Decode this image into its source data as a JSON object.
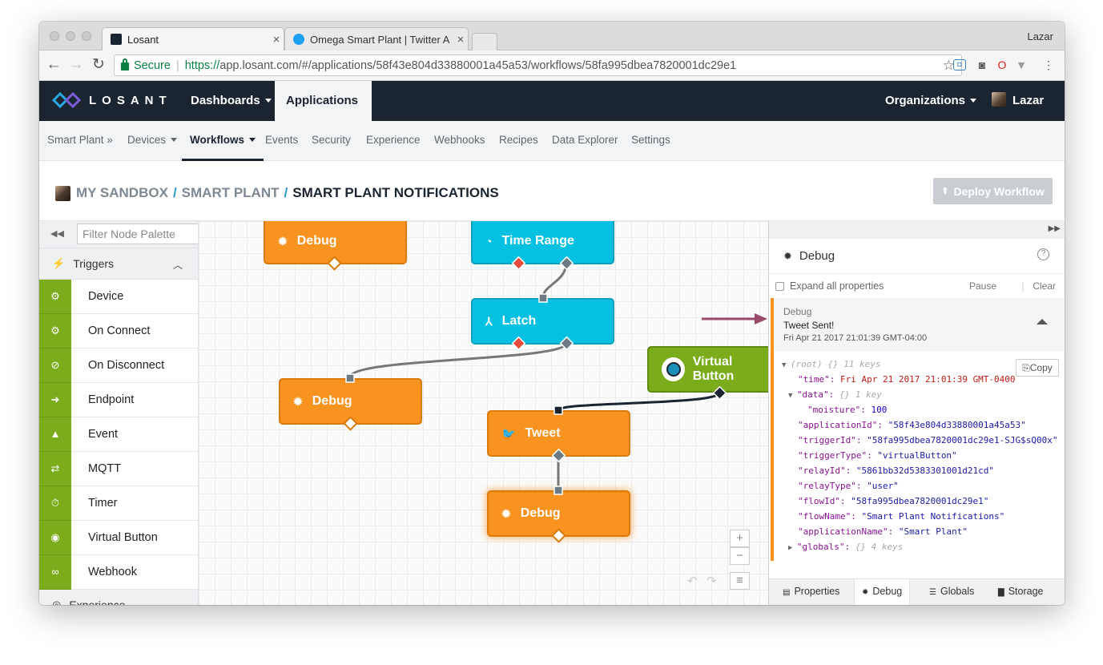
{
  "browser": {
    "tabs": [
      {
        "title": "Losant",
        "close": "×"
      },
      {
        "title": "Omega Smart Plant | Twitter A",
        "close": "×"
      }
    ],
    "profile": "Lazar",
    "secure_label": "Secure",
    "url_scheme": "https://",
    "url_rest": "app.losant.com/#/applications/58f43e804d33880001a45a53/workflows/58fa995dbea7820001dc29e1",
    "back": "←",
    "forward": "→",
    "reload": "↻",
    "star": "☆",
    "menu": "⋮"
  },
  "appnav": {
    "logo_text": "LOSANT",
    "items": [
      {
        "label": "Dashboards"
      },
      {
        "label": "Applications"
      }
    ],
    "organizations": "Organizations",
    "user": "Lazar"
  },
  "subnav": {
    "items": [
      "Smart Plant »",
      "Devices",
      "Workflows",
      "Events",
      "Security",
      "Experience",
      "Webhooks",
      "Recipes",
      "Data Explorer",
      "Settings"
    ]
  },
  "breadcrumb": {
    "sandbox": "MY SANDBOX",
    "app": "SMART PLANT",
    "current": "SMART PLANT NOTIFICATIONS",
    "sep": "/"
  },
  "deploy_label": "Deploy Workflow",
  "palette": {
    "filter_placeholder": "Filter Node Palette",
    "section": "Triggers",
    "items": [
      {
        "label": "Device",
        "icon": "gear-icon",
        "glyph": "⚙"
      },
      {
        "label": "On Connect",
        "icon": "plug-icon",
        "glyph": "⚙"
      },
      {
        "label": "On Disconnect",
        "icon": "disconnect-icon",
        "glyph": "⊘"
      },
      {
        "label": "Endpoint",
        "icon": "endpoint-icon",
        "glyph": "➜"
      },
      {
        "label": "Event",
        "icon": "warning-icon",
        "glyph": "▲"
      },
      {
        "label": "MQTT",
        "icon": "exchange-icon",
        "glyph": "⇄"
      },
      {
        "label": "Timer",
        "icon": "stopwatch-icon",
        "glyph": "⏱"
      },
      {
        "label": "Virtual Button",
        "icon": "radio-button-icon",
        "glyph": "◉"
      },
      {
        "label": "Webhook",
        "icon": "link-icon",
        "glyph": "∞"
      }
    ],
    "next_section": "Experience"
  },
  "canvas": {
    "nodes": {
      "debug_top": "Debug",
      "time_range": "Time Range",
      "latch": "Latch",
      "debug_mid": "Debug",
      "virtual_button": "Virtual Button",
      "tweet": "Tweet",
      "debug_bottom": "Debug"
    },
    "zoom_in": "+",
    "zoom_out": "−",
    "undo": "↶",
    "redo": "↷",
    "menu": "≡"
  },
  "debug_panel": {
    "title": "Debug",
    "help": "?",
    "expand_all": "Expand all properties",
    "pause": "Pause",
    "clear": "Clear",
    "message": {
      "label": "Debug",
      "text": "Tweet Sent!",
      "timestamp": "Fri Apr 21 2017 21:01:39 GMT-04:00"
    },
    "copy_label": "Copy",
    "json": {
      "root": "(root)",
      "root_hint": "{} 11 keys",
      "time": "Fri Apr 21 2017 21:01:39 GMT-0400",
      "data_hint": "{} 1 key",
      "moisture": "100",
      "applicationId": "\"58f43e804d33880001a45a53\"",
      "triggerId": "\"58fa995dbea7820001dc29e1-SJG$sQ00x\"",
      "triggerType": "\"virtualButton\"",
      "relayId": "\"5861bb32d5383301001d21cd\"",
      "relayType": "\"user\"",
      "flowId": "\"58fa995dbea7820001dc29e1\"",
      "flowName": "\"Smart Plant Notifications\"",
      "applicationName": "\"Smart Plant\"",
      "globals_hint": "{} 4 keys"
    },
    "tabs": [
      "Properties",
      "Debug",
      "Globals",
      "Storage"
    ]
  },
  "colors": {
    "brand_dark": "#1b2532",
    "trigger_green": "#7aac1b",
    "output_orange": "#f7931e",
    "logic_cyan": "#06c0e2",
    "annotation_arrow": "#9b4a6b"
  }
}
